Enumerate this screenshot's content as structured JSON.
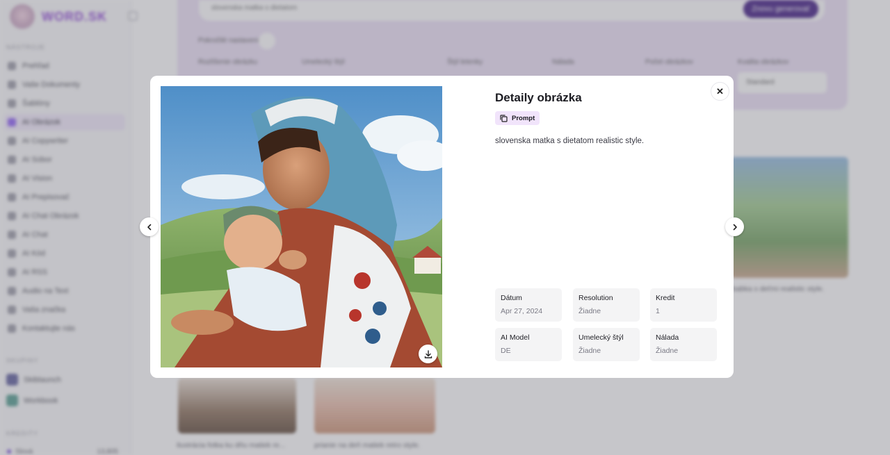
{
  "app": {
    "logo_text": "WORD.SK",
    "sidebar": {
      "section_main": "NÁSTROJE",
      "items": [
        {
          "label": "Prehľad"
        },
        {
          "label": "Vaše Dokumenty"
        },
        {
          "label": "Šablóny"
        },
        {
          "label": "AI Obrázok"
        },
        {
          "label": "AI Copywriter"
        },
        {
          "label": "AI Súbor"
        },
        {
          "label": "AI Vision"
        },
        {
          "label": "AI Prepisovač"
        },
        {
          "label": "AI Chat Obrázok"
        },
        {
          "label": "AI Chat"
        },
        {
          "label": "AI Kód"
        },
        {
          "label": "AI RSS"
        },
        {
          "label": "Audio na Text"
        },
        {
          "label": "Vaša značka"
        },
        {
          "label": "Kontaktujte nás"
        }
      ],
      "section_workspaces": "SKUPINY",
      "workspaces": [
        {
          "label": "Skiblaunch",
          "color": "#5a5a9a"
        },
        {
          "label": "Workbook",
          "color": "#4e9a8c"
        }
      ],
      "section_credits": "KREDITY",
      "credit_label": "Slová",
      "credit_value": "13,805"
    },
    "generator": {
      "prompt_value": "slovenska matka s dietatom",
      "generate_label": "Znovu generovať",
      "advanced_label": "Pokročilé nastavenia",
      "filters": [
        {
          "label": "Rozlíšenie obrázku",
          "value": ""
        },
        {
          "label": "Umelecký štýl",
          "value": ""
        },
        {
          "label": "Štýl letenky",
          "value": ""
        },
        {
          "label": "Nálada",
          "value": ""
        },
        {
          "label": "Počet obrázkov",
          "value": ""
        },
        {
          "label": "Kvalita obrázkov",
          "value": "Standard"
        }
      ]
    },
    "gallery": {
      "captions": [
        "babka s deťmi realistic style.",
        "ilustrácia fotka ku dňu matiek re...",
        "prianie na deň matiek retro style."
      ]
    }
  },
  "modal": {
    "title": "Detaily obrázka",
    "prompt_chip_label": "Prompt",
    "prompt_text": "slovenska matka s dietatom realistic style.",
    "meta": [
      {
        "label": "Dátum",
        "value": "Apr 27, 2024"
      },
      {
        "label": "Resolution",
        "value": "Žiadne"
      },
      {
        "label": "Kredit",
        "value": "1"
      },
      {
        "label": "AI Model",
        "value": "DE"
      },
      {
        "label": "Umelecký štýl",
        "value": "Žiadne"
      },
      {
        "label": "Nálada",
        "value": "Žiadne"
      }
    ]
  }
}
